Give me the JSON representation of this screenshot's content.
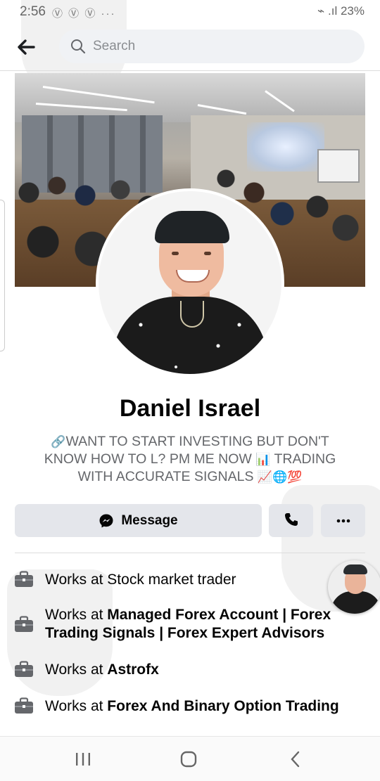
{
  "status_bar": {
    "time": "2:56",
    "app_icons": "Ⓥ Ⓥ Ⓥ ···",
    "battery": "23%",
    "signal_icons": "⌁ .ıl"
  },
  "search": {
    "placeholder": "Search"
  },
  "profile": {
    "name": "Daniel Israel",
    "bio_line1": "WANT TO START INVESTING BUT DON'T",
    "bio_line2": "KNOW HOW TO L? PM ME NOW",
    "bio_line2_suffix": "TRADING",
    "bio_line3": "WITH ACCURATE SIGNALS",
    "bio_emoji_link": "🔗",
    "bio_emoji_chart": "📊",
    "bio_emoji_trend": "📈",
    "bio_emoji_globe": "🌐",
    "bio_emoji_100": "💯"
  },
  "actions": {
    "message_label": "Message"
  },
  "works": [
    {
      "prefix": "Works at ",
      "place": "Stock market trader",
      "bold": false
    },
    {
      "prefix": "Works at ",
      "place": "Managed Forex Account | Forex Trading Signals | Forex Expert Advisors",
      "bold": true
    },
    {
      "prefix": "Works at ",
      "place": "Astrofx",
      "bold": true
    },
    {
      "prefix": "Works at ",
      "place": "Forex And Binary Option Trading",
      "bold": true
    }
  ],
  "colors": {
    "button_bg": "#e4e6eb",
    "text_primary": "#050505",
    "text_secondary": "#65676b"
  }
}
